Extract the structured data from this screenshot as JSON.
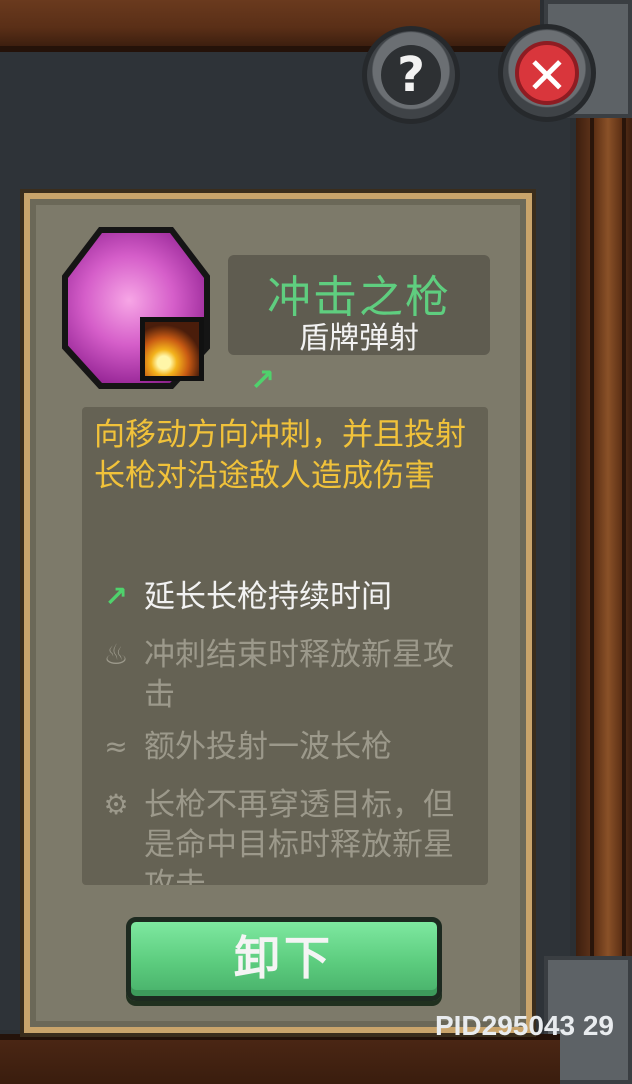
{
  "skill": {
    "name": "冲击之枪",
    "subtitle": "盾牌弹射",
    "description": "向移动方向冲刺，并且投射长枪对沿途敌人造成伤害"
  },
  "upgrades": [
    {
      "icon": "green-arrow-icon",
      "label": "延长长枪持续时间",
      "active": true
    },
    {
      "icon": "flame-icon",
      "label": "冲刺结束时释放新星攻击",
      "active": false
    },
    {
      "icon": "wave-icon",
      "label": "额外投射一波长枪",
      "active": false
    },
    {
      "icon": "gear-icon",
      "label": "长枪不再穿透目标，但是命中目标时释放新星攻击",
      "active": false
    }
  ],
  "buttons": {
    "help": "?",
    "close": "✕",
    "unequip": "卸下"
  },
  "footer": {
    "pid": "PID295043  29"
  },
  "colors": {
    "title_green": "#5fce7f",
    "desc_yellow": "#f1c23a",
    "button_green": "#5ccc7e",
    "close_red": "#d9363c"
  }
}
